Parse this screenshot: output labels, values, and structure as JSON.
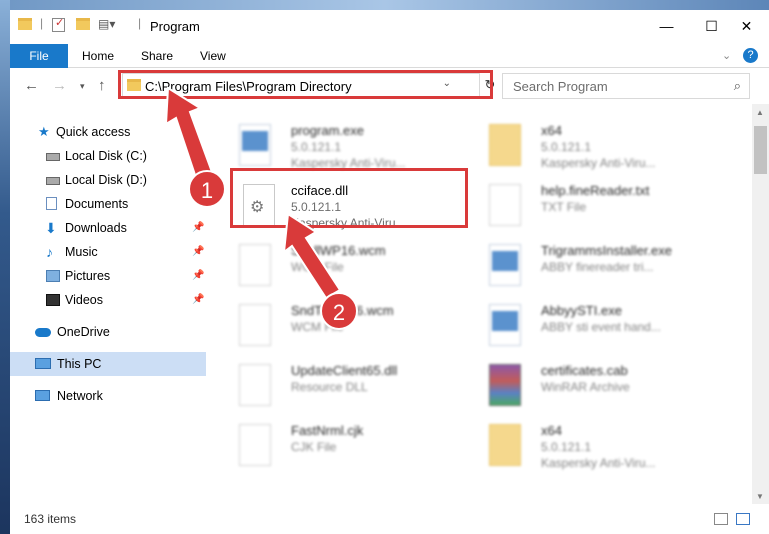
{
  "window": {
    "title": "Program",
    "controls": {
      "minimize": "—",
      "maximize": "☐",
      "close": "✕"
    }
  },
  "ribbon": {
    "tabs": [
      "File",
      "Home",
      "Share",
      "View"
    ],
    "help": "?"
  },
  "address": {
    "path": "C:\\Program Files\\Program Directory",
    "refresh": "↻",
    "dropdown": "⌄"
  },
  "search": {
    "placeholder": "Search Program"
  },
  "nav": {
    "quick_access": "Quick access",
    "items": [
      {
        "label": "Local Disk (C:)",
        "icon": "drive-icon",
        "pinned": false
      },
      {
        "label": "Local Disk (D:)",
        "icon": "drive-icon",
        "pinned": false
      },
      {
        "label": "Documents",
        "icon": "documents-icon",
        "pinned": true
      },
      {
        "label": "Downloads",
        "icon": "downloads-icon",
        "pinned": true
      },
      {
        "label": "Music",
        "icon": "music-icon",
        "pinned": true
      },
      {
        "label": "Pictures",
        "icon": "pictures-icon",
        "pinned": true
      },
      {
        "label": "Videos",
        "icon": "videos-icon",
        "pinned": true
      }
    ],
    "onedrive": "OneDrive",
    "this_pc": "This PC",
    "network": "Network"
  },
  "files": [
    {
      "name": "program.exe",
      "line2": "5.0.121.1",
      "line3": "Kaspersky Anti-Viru...",
      "icon": "app-icon"
    },
    {
      "name": "x64",
      "line2": "5.0.121.1",
      "line3": "Kaspersky Anti-Viru...",
      "icon": "folder-icon"
    },
    {
      "name": "cciface.dll",
      "line2": "5.0.121.1",
      "line3": "Kaspersky Anti-Viru...",
      "icon": "dll-gear-icon"
    },
    {
      "name": "help.fineReader.txt",
      "line2": "TXT File",
      "line3": "",
      "icon": "text-file-icon"
    },
    {
      "name": "SpellWP16.wcm",
      "line2": "WCM File",
      "line3": "",
      "icon": "file-icon"
    },
    {
      "name": "TrigrammsInstaller.exe",
      "line2": "ABBY finereader tri...",
      "line3": "",
      "icon": "app-icon"
    },
    {
      "name": "SndToWP16.wcm",
      "line2": "WCM File",
      "line3": "",
      "icon": "file-icon"
    },
    {
      "name": "AbbyySTI.exe",
      "line2": "ABBY sti event hand...",
      "line3": "",
      "icon": "app-icon"
    },
    {
      "name": "UpdateClient65.dll",
      "line2": "Resource DLL",
      "line3": "",
      "icon": "dll-gear-icon"
    },
    {
      "name": "certificates.cab",
      "line2": "WinRAR Archive",
      "line3": "",
      "icon": "winrar-icon"
    },
    {
      "name": "FastNrml.cjk",
      "line2": "CJK File",
      "line3": "",
      "icon": "file-icon"
    },
    {
      "name": "x64",
      "line2": "5.0.121.1",
      "line3": "Kaspersky Anti-Viru...",
      "icon": "folder-icon"
    }
  ],
  "status": {
    "count": "163 items"
  },
  "callouts": [
    "1",
    "2"
  ],
  "colors": {
    "accent": "#1979ca",
    "highlight": "#d93a3a",
    "selected_nav": "#ccdef5"
  }
}
